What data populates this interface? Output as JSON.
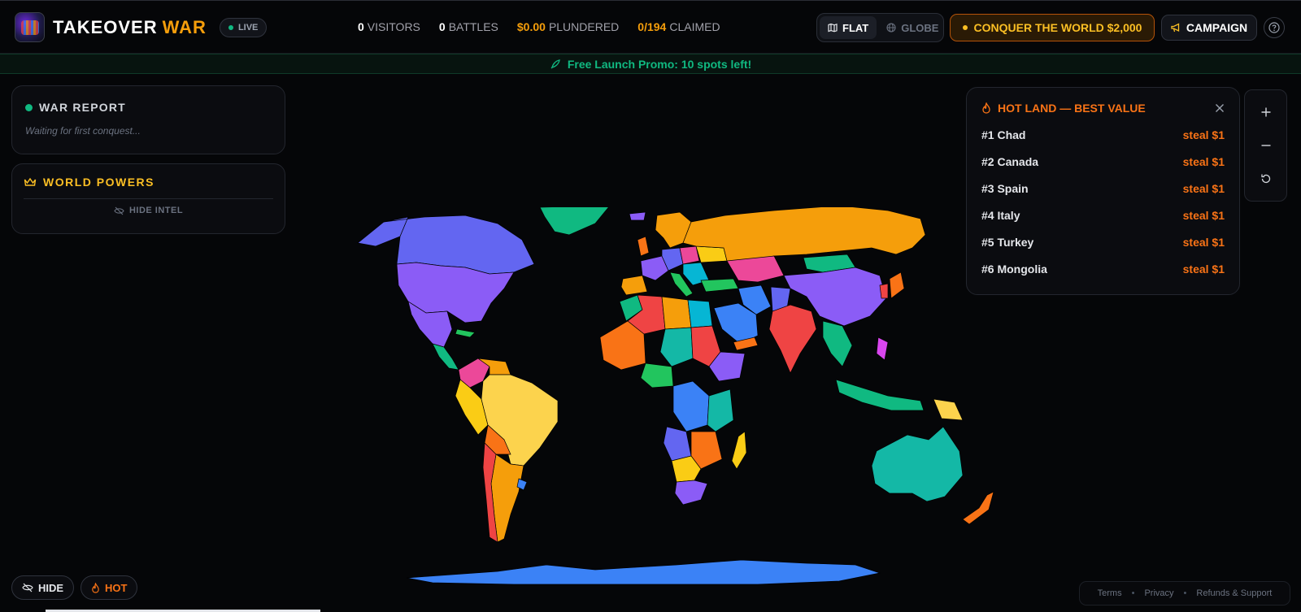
{
  "brand": {
    "name": "TAKEOVER",
    "accent": "WAR",
    "live": "LIVE"
  },
  "stats": {
    "visitors": {
      "value": "0",
      "label": "VISITORS"
    },
    "battles": {
      "value": "0",
      "label": "BATTLES"
    },
    "plundered": {
      "value": "$0.00",
      "label": "PLUNDERED"
    },
    "claimed": {
      "value": "0",
      "total": "/194",
      "label": "CLAIMED"
    }
  },
  "view_toggle": {
    "flat": "FLAT",
    "globe": "GLOBE",
    "active": "flat"
  },
  "conquer_button": "CONQUER THE WORLD $2,000",
  "campaign_button": "CAMPAIGN",
  "promo": "Free Launch Promo: 10 spots left!",
  "war_report": {
    "title": "WAR REPORT",
    "empty_text": "Waiting for first conquest..."
  },
  "world_powers": {
    "title": "WORLD POWERS",
    "hide_intel": "HIDE INTEL"
  },
  "hot_land": {
    "title": "HOT LAND — BEST VALUE",
    "items": [
      {
        "rank": "#1 Chad",
        "price": "steal $1"
      },
      {
        "rank": "#2 Canada",
        "price": "steal $1"
      },
      {
        "rank": "#3 Spain",
        "price": "steal $1"
      },
      {
        "rank": "#4 Italy",
        "price": "steal $1"
      },
      {
        "rank": "#5 Turkey",
        "price": "steal $1"
      },
      {
        "rank": "#6 Mongolia",
        "price": "steal $1"
      }
    ]
  },
  "bottom": {
    "hide": "HIDE",
    "hot": "HOT"
  },
  "footer": {
    "terms": "Terms",
    "privacy": "Privacy",
    "refunds": "Refunds & Support"
  },
  "colors": {
    "accent_orange": "#f59e0b",
    "hot_orange": "#f97316",
    "live_green": "#10b981",
    "background": "#050608"
  }
}
